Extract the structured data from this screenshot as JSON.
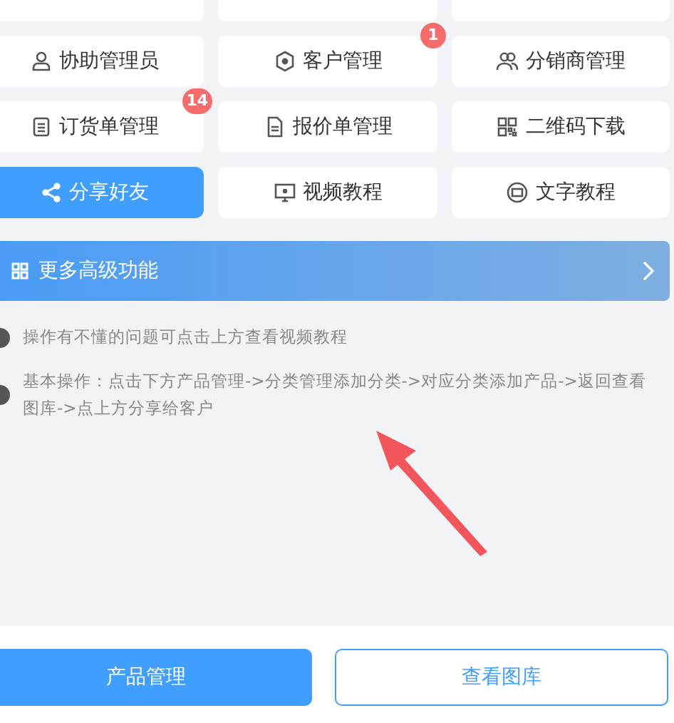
{
  "menu": [
    {
      "label": "协助管理员",
      "selected": false
    },
    {
      "label": "客户管理",
      "selected": false,
      "badge": "1"
    },
    {
      "label": "分销商管理",
      "selected": false
    },
    {
      "label": "订货单管理",
      "selected": false,
      "badge": "14"
    },
    {
      "label": "报价单管理",
      "selected": false
    },
    {
      "label": "二维码下载",
      "selected": false
    },
    {
      "label": "分享好友",
      "selected": true
    },
    {
      "label": "视频教程",
      "selected": false
    },
    {
      "label": "文字教程",
      "selected": false
    }
  ],
  "banner": {
    "label": "更多高级功能"
  },
  "tips": [
    "操作有不懂的问题可点击上方查看视频教程",
    "基本操作：点击下方产品管理->分类管理添加分类->对应分类添加产品->返回查看图库->点上方分享给客户"
  ],
  "buttons": [
    {
      "label": "产品管理",
      "kind": "primary"
    },
    {
      "label": "查看图库",
      "kind": "outline"
    }
  ]
}
